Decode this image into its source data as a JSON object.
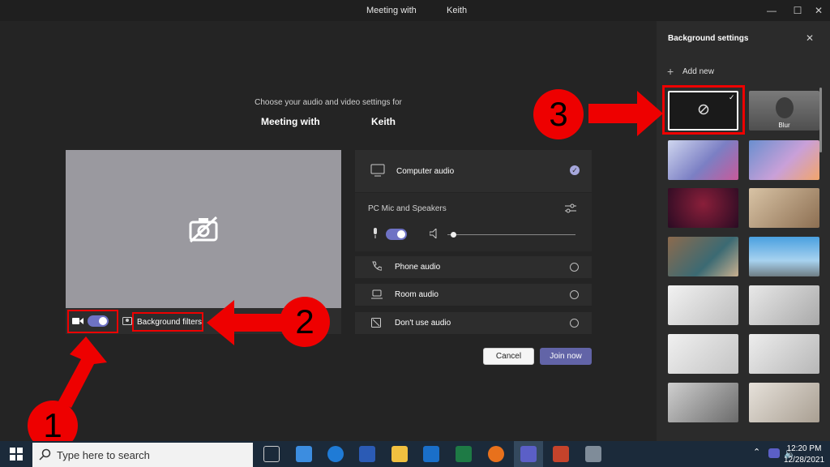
{
  "titlebar": {
    "title_left": "Meeting with",
    "title_right": "Keith"
  },
  "prejoin": {
    "subtitle": "Choose your audio and video settings for",
    "meeting_left": "Meeting with",
    "meeting_right": "Keith",
    "background_filters": "Background filters"
  },
  "audio": {
    "computer_audio": "Computer audio",
    "device": "PC Mic and Speakers",
    "phone_audio": "Phone audio",
    "room_audio": "Room audio",
    "no_audio": "Don't use audio"
  },
  "actions": {
    "cancel": "Cancel",
    "join": "Join now"
  },
  "panel": {
    "title": "Background settings",
    "add_new": "Add new",
    "blur_label": "Blur"
  },
  "annotations": {
    "step1": "1",
    "step2": "2",
    "step3": "3"
  },
  "taskbar": {
    "search_placeholder": "Type here to search",
    "time": "12:20 PM",
    "date": "12/28/2021"
  },
  "colors": {
    "accent": "#6264a7",
    "annotation": "#e00000"
  }
}
